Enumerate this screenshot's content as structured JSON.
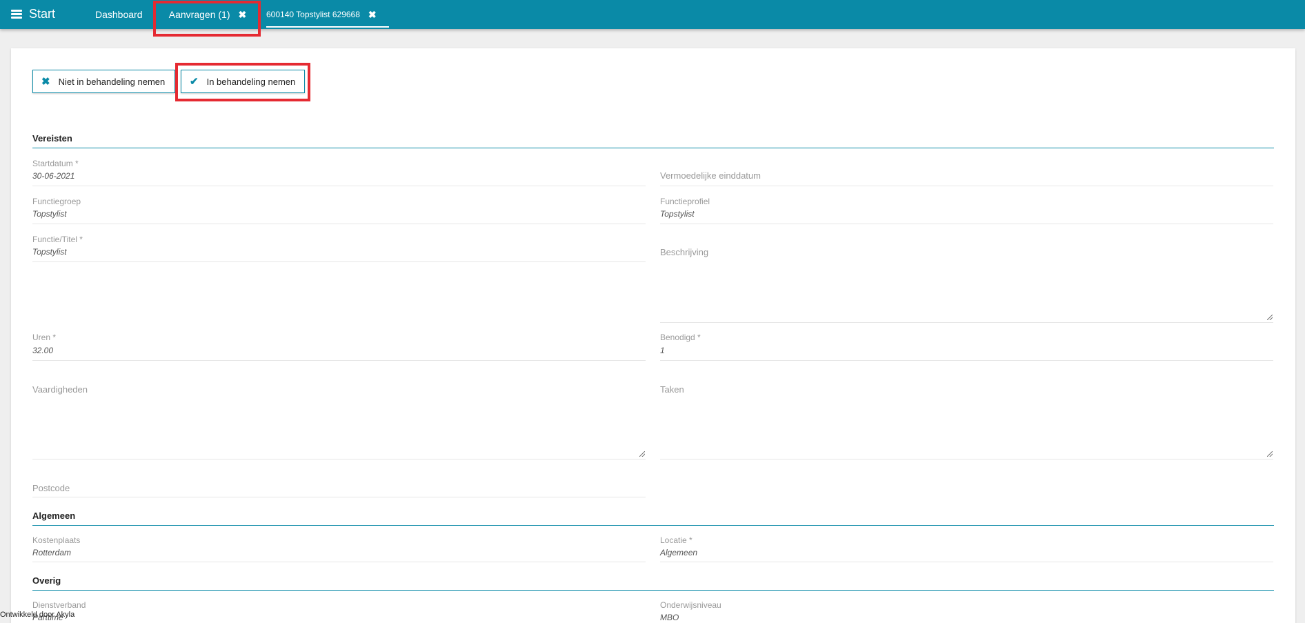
{
  "header": {
    "menu_label": "Start",
    "tabs": [
      {
        "label": "Dashboard"
      },
      {
        "label": "Aanvragen (1)",
        "close": "✖"
      },
      {
        "label": "600140 Topstylist 629668",
        "close": "✖"
      }
    ]
  },
  "actions": {
    "reject_label": "Niet in behandeling nemen",
    "reject_icon": "✖",
    "accept_label": "In behandeling nemen",
    "accept_icon": "✔"
  },
  "sections": {
    "vereisten": "Vereisten",
    "algemeen": "Algemeen",
    "overig": "Overig"
  },
  "fields": {
    "startdatum": {
      "label": "Startdatum *",
      "value": "30-06-2021"
    },
    "einddatum": {
      "label": "Vermoedelijke einddatum",
      "value": ""
    },
    "functiegroep": {
      "label": "Functiegroep",
      "value": "Topstylist"
    },
    "functieprofiel": {
      "label": "Functieprofiel",
      "value": "Topstylist"
    },
    "functietitel": {
      "label": "Functie/Titel *",
      "value": "Topstylist"
    },
    "beschrijving": {
      "label": "Beschrijving",
      "value": ""
    },
    "uren": {
      "label": "Uren *",
      "value": "32.00"
    },
    "benodigd": {
      "label": "Benodigd *",
      "value": "1"
    },
    "vaardigheden": {
      "label": "Vaardigheden",
      "value": ""
    },
    "taken": {
      "label": "Taken",
      "value": ""
    },
    "postcode": {
      "label": "Postcode",
      "value": ""
    },
    "kostenplaats": {
      "label": "Kostenplaats",
      "value": "Rotterdam"
    },
    "locatie": {
      "label": "Locatie *",
      "value": "Algemeen"
    },
    "dienstverband": {
      "label": "Dienstverband",
      "value": "Parttime"
    },
    "onderwijsniveau": {
      "label": "Onderwijsniveau",
      "value": "MBO"
    }
  },
  "footer": {
    "text": "Ontwikkeld door Akyla"
  },
  "colors": {
    "primary": "#0a8aa7",
    "highlight": "#e52a32"
  }
}
